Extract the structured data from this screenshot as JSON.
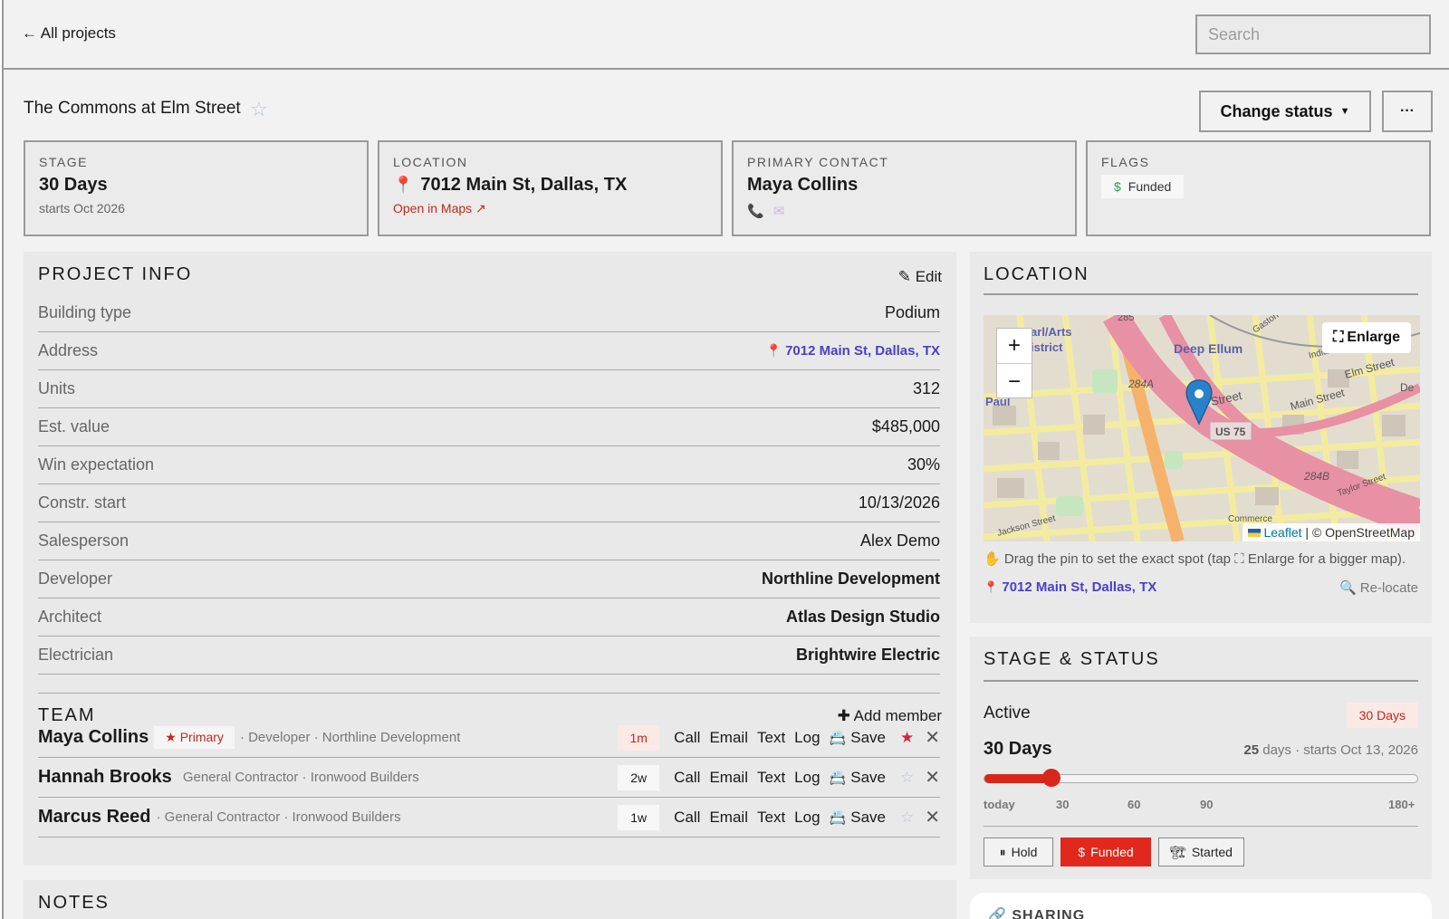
{
  "nav": {
    "back_label": "← All projects",
    "search_placeholder": "Search"
  },
  "project": {
    "title": "The Commons at Elm Street",
    "change_status_label": "Change status",
    "more_label": "···"
  },
  "summary": {
    "stage": {
      "label": "STAGE",
      "value": "30 Days",
      "sub": "starts Oct 2026"
    },
    "location": {
      "label": "LOCATION",
      "value": "7012 Main St, Dallas, TX",
      "link": "Open in Maps ↗"
    },
    "contact": {
      "label": "PRIMARY CONTACT",
      "value": "Maya Collins"
    },
    "flags": {
      "label": "FLAGS",
      "pill": "Funded"
    }
  },
  "project_info": {
    "title": "PROJECT INFO",
    "edit_label": "Edit",
    "rows": [
      {
        "label": "Building type",
        "value": "Podium"
      },
      {
        "label": "Address",
        "value": "7012 Main St, Dallas, TX"
      },
      {
        "label": "Units",
        "value": "312"
      },
      {
        "label": "Est. value",
        "value": "$485,000"
      },
      {
        "label": "Win expectation",
        "value": "30%"
      },
      {
        "label": "Constr. start",
        "value": "10/13/2026"
      },
      {
        "label": "Salesperson",
        "value": "Alex Demo"
      },
      {
        "label": "Developer",
        "value": "Northline Development"
      },
      {
        "label": "Architect",
        "value": "Atlas Design Studio"
      },
      {
        "label": "Electrician",
        "value": "Brightwire Electric"
      }
    ]
  },
  "team": {
    "title": "TEAM",
    "add_label": "Add member",
    "actions": {
      "call": "Call",
      "email": "Email",
      "text": "Text",
      "log": "Log",
      "save": "Save"
    },
    "members": [
      {
        "name": "Maya Collins",
        "badge": "★ Primary",
        "role": "· Developer · Northline Development",
        "age": "1m",
        "starred": true
      },
      {
        "name": "Hannah Brooks",
        "role": "General Contractor · Ironwood Builders",
        "age": "2w",
        "starred": false
      },
      {
        "name": "Marcus Reed",
        "role": "· General Contractor · Ironwood Builders",
        "age": "1w",
        "starred": false
      }
    ]
  },
  "notes": {
    "title": "NOTES"
  },
  "location_panel": {
    "title": "LOCATION",
    "enlarge_label": "Enlarge",
    "attribution_leaflet": "Leaflet",
    "attribution_osm": "| © OpenStreetMap",
    "hint": "Drag the pin to set the exact spot (tap ⛶ Enlarge for a bigger map).",
    "address": "7012 Main St, Dallas, TX",
    "relocate_label": "Re-locate",
    "map_labels": {
      "arts": "arl/Arts",
      "district": "istrict",
      "deep_ellum": "Deep Ellum",
      "street1": "Street",
      "elm": "Elm Street",
      "main": "Main Street",
      "us75": "US 75",
      "r284a": "284A",
      "r284b": "284B",
      "taylor": "Taylor Street",
      "jackson": "Jackson Street",
      "paul": "Paul",
      "gaston": "Gaston",
      "indian": "Indian",
      "commerce": "Commerce",
      "de": "De",
      "n285": "285"
    }
  },
  "stage_status": {
    "title": "STAGE & STATUS",
    "status": "Active",
    "stage_pill": "30 Days",
    "days_label": "30 Days",
    "days_remaining": "25",
    "days_meta": "days · starts Oct 13, 2026",
    "slider_fraction": 0.155,
    "ticks": [
      "today",
      "30",
      "60",
      "90",
      "180+"
    ],
    "buttons": [
      {
        "label": "Hold",
        "icon": "⏸",
        "active": false
      },
      {
        "label": "Funded",
        "icon": "$",
        "active": true
      },
      {
        "label": "Started",
        "icon": "🏗",
        "active": false
      }
    ]
  },
  "sharing": {
    "title": "SHARING"
  }
}
